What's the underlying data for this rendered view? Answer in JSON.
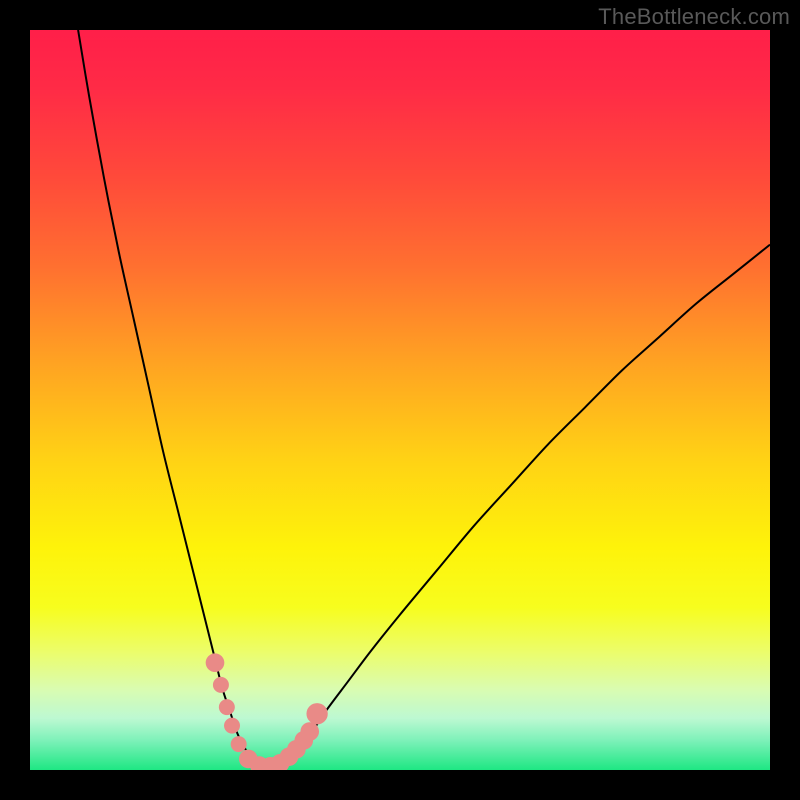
{
  "watermark": "TheBottleneck.com",
  "chart_data": {
    "type": "line",
    "title": "",
    "xlabel": "",
    "ylabel": "",
    "xlim": [
      0,
      100
    ],
    "ylim": [
      0,
      100
    ],
    "gradient_stops": [
      {
        "offset": 0.0,
        "color": "#ff1f49"
      },
      {
        "offset": 0.08,
        "color": "#ff2b46"
      },
      {
        "offset": 0.2,
        "color": "#ff4a3a"
      },
      {
        "offset": 0.32,
        "color": "#ff7030"
      },
      {
        "offset": 0.45,
        "color": "#ffa322"
      },
      {
        "offset": 0.58,
        "color": "#ffd215"
      },
      {
        "offset": 0.7,
        "color": "#fef30a"
      },
      {
        "offset": 0.78,
        "color": "#f7fd1e"
      },
      {
        "offset": 0.84,
        "color": "#ecfd6a"
      },
      {
        "offset": 0.89,
        "color": "#dafcb0"
      },
      {
        "offset": 0.93,
        "color": "#bdf9d2"
      },
      {
        "offset": 0.96,
        "color": "#7df1b9"
      },
      {
        "offset": 1.0,
        "color": "#1ee783"
      }
    ],
    "series": [
      {
        "name": "curve",
        "x": [
          6.5,
          8,
          10,
          12,
          14,
          16,
          18,
          20,
          22,
          24,
          25,
          26,
          27,
          28,
          29,
          30,
          31,
          32,
          33,
          34,
          36,
          38,
          40,
          43,
          46,
          50,
          55,
          60,
          65,
          70,
          75,
          80,
          85,
          90,
          95,
          100
        ],
        "y": [
          100,
          91,
          80,
          70,
          61,
          52,
          43,
          35,
          27,
          19,
          15,
          11,
          8,
          5,
          3,
          1.5,
          0.8,
          0.5,
          0.5,
          1,
          2.5,
          5,
          8,
          12,
          16,
          21,
          27,
          33,
          38.5,
          44,
          49,
          54,
          58.5,
          63,
          67,
          71
        ]
      }
    ],
    "markers": {
      "name": "highlight-points",
      "color": "#e98a87",
      "points": [
        {
          "x": 25.0,
          "y": 14.5,
          "r": 1.4
        },
        {
          "x": 25.8,
          "y": 11.5,
          "r": 1.2
        },
        {
          "x": 26.6,
          "y": 8.5,
          "r": 1.2
        },
        {
          "x": 27.3,
          "y": 6.0,
          "r": 1.2
        },
        {
          "x": 28.2,
          "y": 3.5,
          "r": 1.2
        },
        {
          "x": 29.5,
          "y": 1.5,
          "r": 1.4
        },
        {
          "x": 31.0,
          "y": 0.6,
          "r": 1.4
        },
        {
          "x": 32.5,
          "y": 0.5,
          "r": 1.4
        },
        {
          "x": 33.8,
          "y": 0.9,
          "r": 1.4
        },
        {
          "x": 35.0,
          "y": 1.8,
          "r": 1.4
        },
        {
          "x": 36.0,
          "y": 2.8,
          "r": 1.4
        },
        {
          "x": 37.0,
          "y": 4.0,
          "r": 1.4
        },
        {
          "x": 37.8,
          "y": 5.2,
          "r": 1.4
        },
        {
          "x": 38.8,
          "y": 7.6,
          "r": 1.6
        }
      ]
    }
  }
}
